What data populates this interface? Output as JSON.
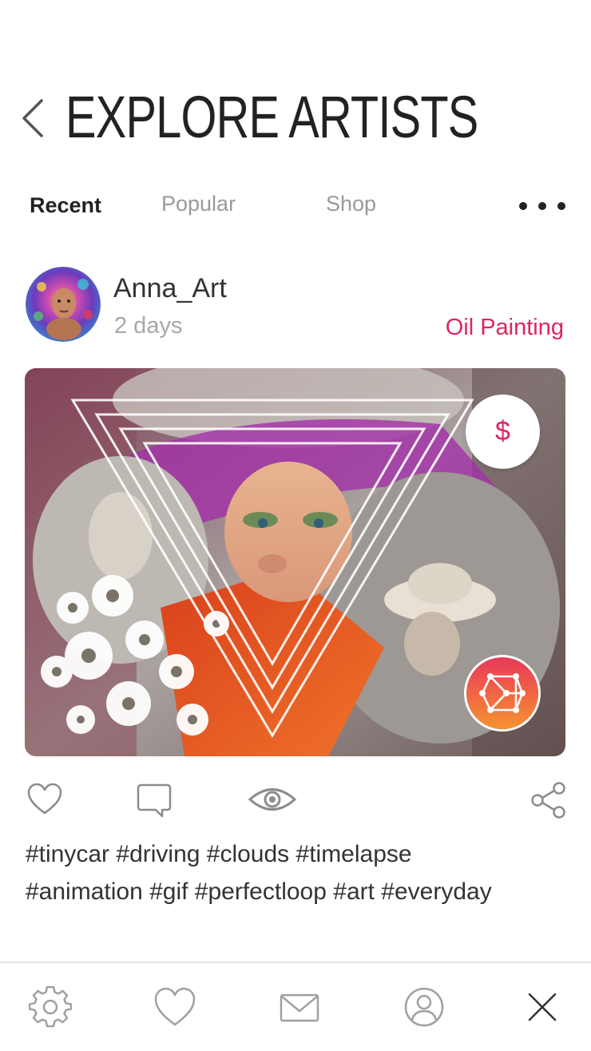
{
  "header": {
    "title": "EXPLORE ARTISTS",
    "back_icon": "chevron-left-icon"
  },
  "tabs": [
    {
      "label": "Recent",
      "active": true
    },
    {
      "label": "Popular",
      "active": false
    },
    {
      "label": "Shop",
      "active": false
    }
  ],
  "more_icon": "more-horizontal-icon",
  "post": {
    "username": "Anna_Art",
    "time": "2 days",
    "category": "Oil Painting",
    "price_symbol": "$",
    "hashtags_line1": "#tinycar #driving #clouds #timelapse",
    "hashtags_line2": "#animation #gif #perfectloop #art #everyday",
    "actions": [
      "heart-icon",
      "comment-icon",
      "eye-icon",
      "share-icon"
    ]
  },
  "bottom_nav": [
    "settings-icon",
    "favorites-icon",
    "mail-icon",
    "profile-icon",
    "close-icon"
  ],
  "colors": {
    "accent": "#e0245e",
    "text": "#222222",
    "muted": "#9a9a9a",
    "icon_gray": "#8c8c8c",
    "gradient_start": "#e8385a",
    "gradient_end": "#f7922f"
  }
}
